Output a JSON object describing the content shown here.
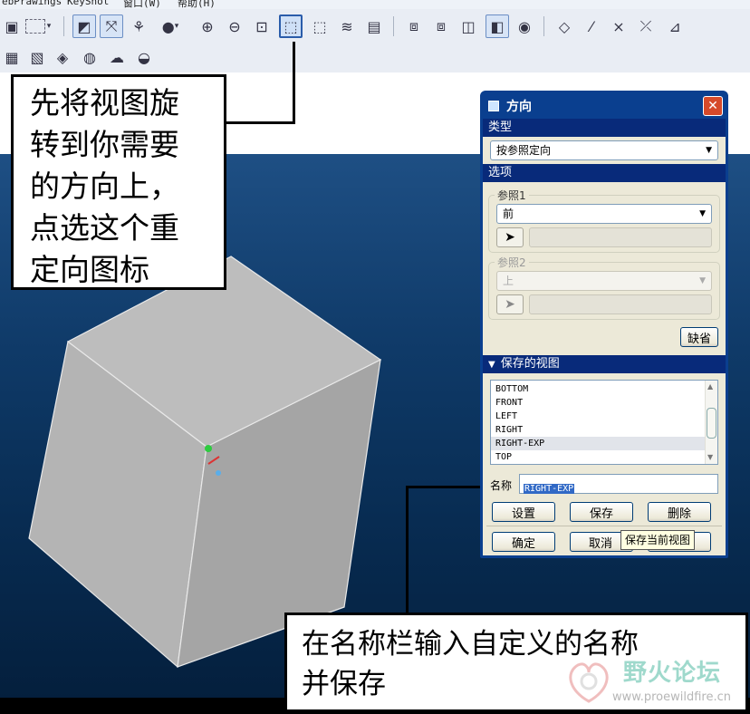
{
  "menubar": {
    "items": [
      "ebPrawings",
      "KeyShot",
      "窗口(W)",
      "帮助(H)"
    ]
  },
  "toolbar": {
    "row1": [
      "zoom-fit-icon",
      "spin-center-icon",
      "datum-display-icon",
      "shading-icon",
      "zoom-in-icon",
      "zoom-out-icon",
      "refit-icon",
      "reorient-icon",
      "saved-views-icon",
      "layers-icon",
      "model-tree-icon",
      "wireframe-icon",
      "hidden-line-icon",
      "no-hidden-icon",
      "shaded-icon",
      "enhanced-realism-icon",
      "plane-display-icon",
      "axis-display-icon",
      "point-display-icon",
      "csys-display-icon",
      "annotation-icon"
    ],
    "row2": [
      "sheet-icon",
      "scene-icon",
      "appearance-icon",
      "render-icon",
      "perspective-icon",
      "color-icon"
    ]
  },
  "callout_top": {
    "lines": [
      "先将视图旋",
      "转到你需要",
      "的方向上，",
      "点选这个重",
      "定向图标"
    ]
  },
  "callout_bottom": {
    "lines": [
      "在名称栏输入自定义的名称",
      "并保存"
    ]
  },
  "dialog": {
    "title": "方向",
    "close": "✕",
    "type_section": "类型",
    "type_value": "按参照定向",
    "options_section": "选项",
    "ref1_label": "参照1",
    "ref1_value": "前",
    "ref2_label": "参照2",
    "ref2_value": "上",
    "default_button": "缺省",
    "saved_views_section": "保存的视图",
    "saved_views": [
      "BOTTOM",
      "FRONT",
      "LEFT",
      "RIGHT",
      "RIGHT-EXP",
      "TOP"
    ],
    "selected_view": "RIGHT-EXP",
    "name_label": "名称",
    "name_value": "RIGHT-EXP",
    "set_button": "设置",
    "save_button": "保存",
    "delete_button": "删除",
    "ok_button": "确定",
    "cancel_button": "取消",
    "tooltip": "保存当前视图"
  },
  "watermark": {
    "text": "野火论坛",
    "url": "www.proewildfire.cn"
  },
  "colors": {
    "accent": "#0a3f8f",
    "section": "#082a7a",
    "background_top": "#1e4f84",
    "background_bottom": "#041e3b",
    "cube_face": "#a9a9a9"
  }
}
